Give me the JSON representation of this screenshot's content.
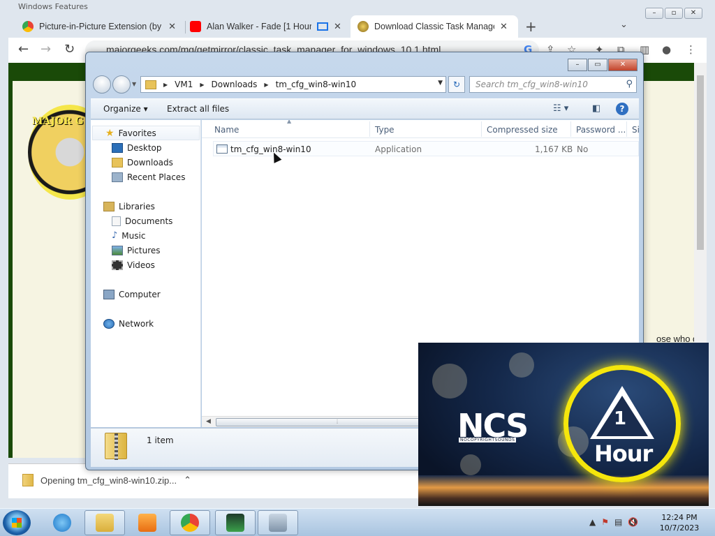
{
  "os": {
    "background_window_title": "Windows Features",
    "taskbar": {
      "clock_time": "12:24 PM",
      "clock_date": "10/7/2023",
      "items": [
        "file-explorer",
        "internet-explorer",
        "media-player",
        "chrome",
        "task-manager",
        "installer"
      ]
    }
  },
  "chrome": {
    "tabs": [
      {
        "title": "Picture-in-Picture Extension (by G",
        "active": false
      },
      {
        "title": "Alan Walker - Fade [1 Hour V",
        "active": false
      },
      {
        "title": "Download Classic Task Manager f",
        "active": true
      }
    ],
    "url": "majorgeeks.com/mg/getmirror/classic_task_manager_for_windows_10,1.html",
    "page": {
      "logo_text": "MAJOR G",
      "snippet_1": "ose who d",
      "snippet_2": "......"
    },
    "download_bar": {
      "item": "Opening tm_cfg_win8-win10.zip..."
    }
  },
  "explorer": {
    "breadcrumb": [
      "VM1",
      "Downloads",
      "tm_cfg_win8-win10"
    ],
    "search_placeholder": "Search tm_cfg_win8-win10",
    "commands": {
      "organize": "Organize",
      "extract": "Extract all files"
    },
    "nav": {
      "favorites": "Favorites",
      "desktop": "Desktop",
      "downloads": "Downloads",
      "recent": "Recent Places",
      "libraries": "Libraries",
      "documents": "Documents",
      "music": "Music",
      "pictures": "Pictures",
      "videos": "Videos",
      "computer": "Computer",
      "network": "Network"
    },
    "columns": {
      "name": "Name",
      "type": "Type",
      "compressed": "Compressed size",
      "password": "Password ...",
      "size": "Si"
    },
    "files": [
      {
        "name": "tm_cfg_win8-win10",
        "type": "Application",
        "compressed": "1,167 KB",
        "password": "No"
      }
    ],
    "status": {
      "count": "1 item"
    }
  },
  "pip_video": {
    "logo": "NCS",
    "logo_sub": "NOCOPYRIGHTSOUNDS",
    "badge_number": "1",
    "badge_word": "Hour",
    "colors": {
      "ring": "#f5e60c",
      "sky": "#14284a"
    }
  }
}
